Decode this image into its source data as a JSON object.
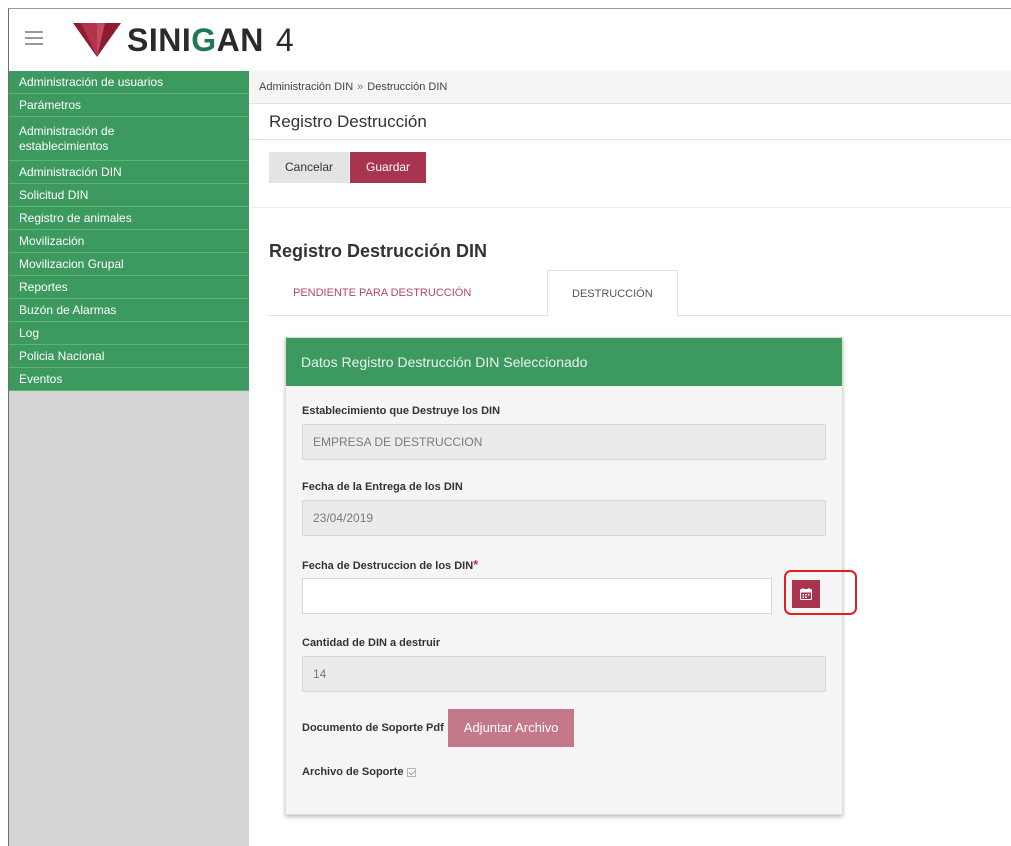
{
  "header": {
    "brand_prefix": "SINI",
    "brand_highlight": "G",
    "brand_suffix": "AN",
    "brand_version": "4"
  },
  "sidebar": {
    "items": [
      {
        "label": "Administración de usuarios"
      },
      {
        "label": "Parámetros"
      },
      {
        "label": "Administración de establecimientos"
      },
      {
        "label": "Administración DIN"
      },
      {
        "label": "Solicitud DIN"
      },
      {
        "label": "Registro de animales"
      },
      {
        "label": "Movilización"
      },
      {
        "label": "Movilizacion Grupal"
      },
      {
        "label": "Reportes"
      },
      {
        "label": "Buzón de Alarmas"
      },
      {
        "label": "Log"
      },
      {
        "label": "Policia Nacional"
      },
      {
        "label": "Eventos"
      }
    ]
  },
  "breadcrumb": {
    "parent": "Administración DIN",
    "separator": "»",
    "current": "Destrucción DIN"
  },
  "page": {
    "title": "Registro Destrucción"
  },
  "actions": {
    "cancel_label": "Cancelar",
    "save_label": "Guardar"
  },
  "section": {
    "title": "Registro Destrucción DIN"
  },
  "tabs": [
    {
      "label": "PENDIENTE PARA DESTRUCCIÓN",
      "active": false
    },
    {
      "label": "DESTRUCCIÓN",
      "active": true
    }
  ],
  "panel": {
    "title": "Datos Registro Destrucción DIN Seleccionado",
    "establishment_label": "Establecimiento que Destruye los DIN",
    "establishment_value": "EMPRESA DE DESTRUCCION",
    "delivery_date_label": "Fecha de la Entrega de los DIN",
    "delivery_date_value": "23/04/2019",
    "destruction_date_label": "Fecha de Destruccion de los DIN",
    "destruction_date_required": "*",
    "destruction_date_value": "",
    "quantity_label": "Cantidad de DIN a destruir",
    "quantity_value": "14",
    "document_label": "Documento de Soporte Pdf",
    "attach_label": "Adjuntar Archivo",
    "support_file_label": "Archivo de Soporte"
  },
  "colors": {
    "primary_green": "#3d9a5f",
    "accent_maroon": "#a8344f",
    "highlight_red": "#e02020"
  }
}
